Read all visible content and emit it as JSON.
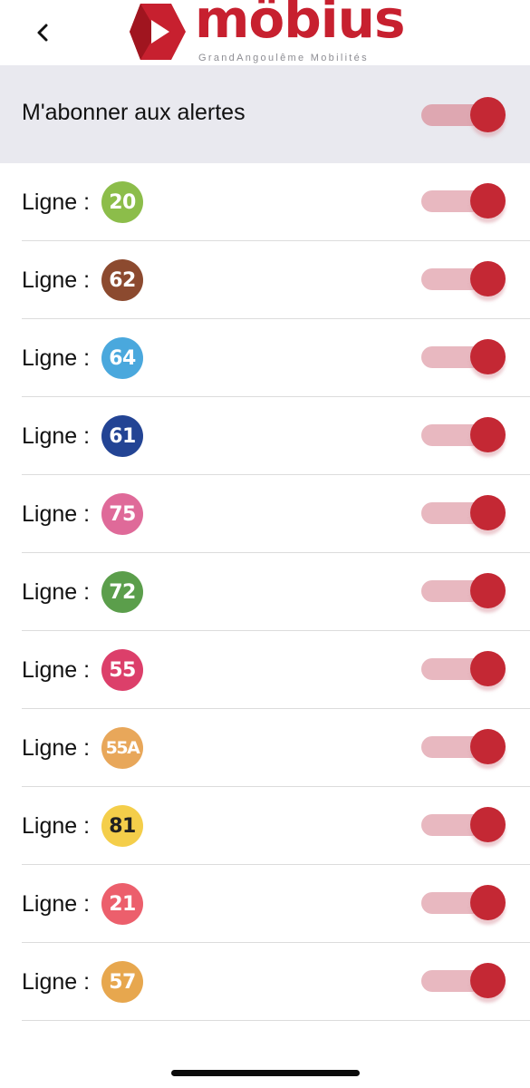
{
  "header": {
    "back_icon": "chevron-left-icon",
    "logo_text": "möbius",
    "logo_tagline": "GrandAngoulême Mobilités",
    "brand_color": "#c7202f"
  },
  "master": {
    "label": "M'abonner aux alertes",
    "enabled": true
  },
  "line_prefix": "Ligne :",
  "lines": [
    {
      "number": "20",
      "color": "#8cbd4a",
      "text_color": "#ffffff",
      "enabled": true
    },
    {
      "number": "62",
      "color": "#8c4a2f",
      "text_color": "#ffffff",
      "enabled": true
    },
    {
      "number": "64",
      "color": "#4aa8dd",
      "text_color": "#ffffff",
      "enabled": true
    },
    {
      "number": "61",
      "color": "#234494",
      "text_color": "#ffffff",
      "enabled": true
    },
    {
      "number": "75",
      "color": "#df6a99",
      "text_color": "#ffffff",
      "enabled": true
    },
    {
      "number": "72",
      "color": "#5b9e4b",
      "text_color": "#ffffff",
      "enabled": true
    },
    {
      "number": "55",
      "color": "#dc3f6a",
      "text_color": "#ffffff",
      "enabled": true
    },
    {
      "number": "55A",
      "color": "#e8a75a",
      "text_color": "#ffffff",
      "enabled": true
    },
    {
      "number": "81",
      "color": "#f4ce4a",
      "text_color": "#222222",
      "enabled": true
    },
    {
      "number": "21",
      "color": "#ec5f6c",
      "text_color": "#ffffff",
      "enabled": true
    },
    {
      "number": "57",
      "color": "#e7a74e",
      "text_color": "#ffffff",
      "enabled": true
    }
  ],
  "toggle_colors": {
    "track_on": "#e8b8c0",
    "knob_on": "#c42834"
  }
}
